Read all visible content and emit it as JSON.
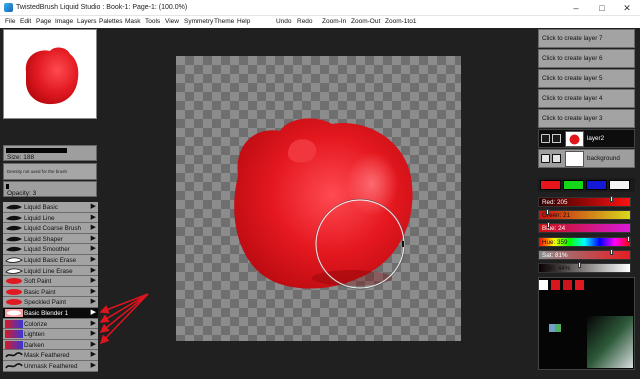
{
  "window": {
    "title": "TwistedBrush Liquid Studio : Book-1: Page-1: (100.0%)",
    "controls": [
      "–",
      "□",
      "✕"
    ]
  },
  "menu": [
    "File",
    "Edit",
    "Page",
    "Image",
    "Layers",
    "Palettes",
    "Mask",
    "Tools",
    "View",
    "Symmetry",
    "Theme",
    "Help",
    "Undo",
    "Redo",
    "Zoom-In",
    "Zoom-Out",
    "Zoom-1to1"
  ],
  "brush_settings": {
    "size": "Size: 188",
    "density_note": "Density not used for the brush",
    "opacity": "Opacity: 3",
    "size_level": 0.66,
    "opacity_level": 0.03
  },
  "brushes": [
    {
      "label": "Liquid Basic",
      "icon": "stroke-icon",
      "selected": false
    },
    {
      "label": "Liquid Line",
      "icon": "stroke-icon",
      "selected": false
    },
    {
      "label": "Liquid Coarse Brush",
      "icon": "stroke-icon",
      "selected": false
    },
    {
      "label": "Liquid Shaper",
      "icon": "stroke-icon",
      "selected": false
    },
    {
      "label": "Liquid Smoother",
      "icon": "stroke-icon",
      "selected": false
    },
    {
      "label": "Liquid Basic Erase",
      "icon": "erase-icon",
      "selected": false
    },
    {
      "label": "Liquid Line Erase",
      "icon": "erase-icon",
      "selected": false
    },
    {
      "label": "Soft Paint",
      "icon": "red-stroke-icon",
      "selected": false
    },
    {
      "label": "Basic Paint",
      "icon": "red-stroke-icon",
      "selected": false
    },
    {
      "label": "Speckled Paint",
      "icon": "red-stroke-icon",
      "selected": false
    },
    {
      "label": "Basic Blender 1",
      "icon": "blender-icon",
      "selected": true
    },
    {
      "label": "Colorize",
      "icon": "blend-gradient-icon",
      "selected": false
    },
    {
      "label": "Lighten",
      "icon": "blend-gradient-icon",
      "selected": false
    },
    {
      "label": "Darken",
      "icon": "blend-gradient-icon",
      "selected": false
    },
    {
      "label": "Mask Feathered",
      "icon": "mask-icon",
      "selected": false
    },
    {
      "label": "Unmask Feathered",
      "icon": "mask-icon",
      "selected": false
    }
  ],
  "layers": {
    "create_buttons": [
      "Click to create layer 7",
      "Click to create layer 6",
      "Click to create layer 5",
      "Click to create layer 4",
      "Click to create layer 3"
    ],
    "items": [
      {
        "name": "layer2",
        "active": true
      },
      {
        "name": "background",
        "active": false
      }
    ]
  },
  "palette": {
    "swatches": [
      "#e8141c",
      "#16d61a",
      "#1618d8",
      "#f4f4f4"
    ],
    "sliders": [
      {
        "label": "Red: 205",
        "value": 205,
        "max": 255,
        "from": "#2a0000",
        "to": "#ff1010",
        "text": "#fff"
      },
      {
        "label": "Green: 21",
        "value": 21,
        "max": 255,
        "from": "#c81212",
        "to": "#d8d81c",
        "text": "#111"
      },
      {
        "label": "Blue: 24",
        "value": 24,
        "max": 255,
        "from": "#c81212",
        "to": "#d81ad8",
        "text": "#fff"
      },
      {
        "label": "Hue: 359",
        "value": 359,
        "max": 359,
        "hue": true,
        "text": "#111"
      },
      {
        "label": "Sat: 81%",
        "value": 81,
        "max": 100,
        "from": "#8a8a8a",
        "to": "#e81c24",
        "text": "#fff"
      },
      {
        "label": "Lum: 44%",
        "value": 44,
        "max": 100,
        "from": "#0a0000",
        "to": "#ffffff",
        "text": "#111"
      }
    ]
  },
  "current_color": "#cd1518"
}
